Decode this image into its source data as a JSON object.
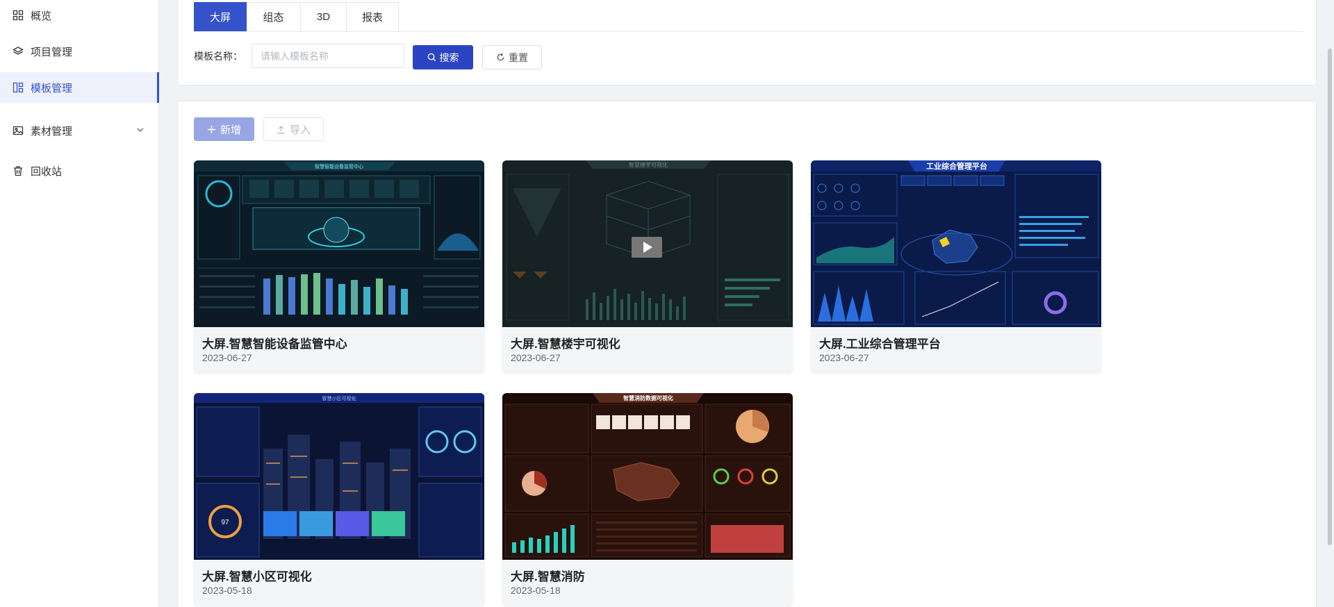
{
  "sidebar": {
    "items": [
      {
        "label": "概览",
        "icon": "grid-icon"
      },
      {
        "label": "项目管理",
        "icon": "layers-icon"
      },
      {
        "label": "模板管理",
        "icon": "template-icon",
        "active": true
      },
      {
        "label": "素材管理",
        "icon": "image-icon",
        "expandable": true
      },
      {
        "label": "回收站",
        "icon": "trash-icon"
      }
    ]
  },
  "tabs": [
    "大屏",
    "组态",
    "3D",
    "报表"
  ],
  "active_tab": "大屏",
  "filter": {
    "label": "模板名称：",
    "placeholder": "请输入模板名称",
    "value": "",
    "search_label": "搜索",
    "reset_label": "重置"
  },
  "toolbar": {
    "add_label": "新增",
    "import_label": "导入"
  },
  "cards": [
    {
      "title": "大屏.智慧智能设备监管中心",
      "date": "2023-06-27",
      "thumb_title": "智慧智能设备监管中心"
    },
    {
      "title": "大屏.智慧楼宇可视化",
      "date": "2023-06-27",
      "thumb_title": "智慧楼宇可视化"
    },
    {
      "title": "大屏.工业综合管理平台",
      "date": "2023-06-27",
      "thumb_title": "工业综合管理平台"
    },
    {
      "title": "大屏.智慧小区可视化",
      "date": "2023-05-18",
      "thumb_title": "智慧小区可视化"
    },
    {
      "title": "大屏.智慧消防",
      "date": "2023-05-18",
      "thumb_title": "智慧消防数据可视化"
    }
  ],
  "colors": {
    "accent": "#3452c9",
    "primary_button": "#2b45c2",
    "disabled_primary": "#98a7e3"
  }
}
